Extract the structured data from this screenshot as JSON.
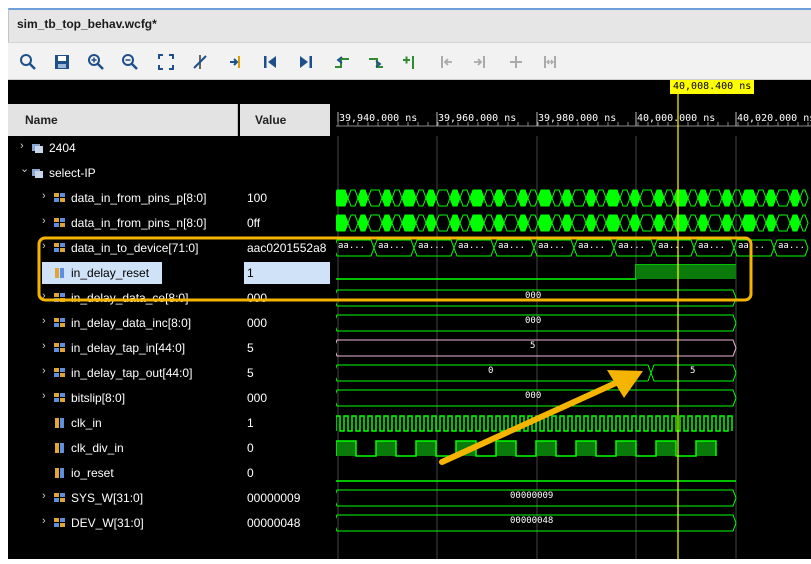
{
  "window": {
    "title": "sim_tb_top_behav.wcfg*"
  },
  "toolbar": {
    "buttons": [
      {
        "name": "search-icon"
      },
      {
        "name": "save-icon"
      },
      {
        "name": "zoom-in-icon"
      },
      {
        "name": "zoom-out-icon"
      },
      {
        "name": "zoom-fit-icon"
      },
      {
        "name": "cursor-clear-icon"
      },
      {
        "name": "go-to-cursor-icon"
      },
      {
        "name": "go-to-start-icon"
      },
      {
        "name": "go-to-end-icon"
      },
      {
        "name": "previous-transition-icon"
      },
      {
        "name": "next-transition-icon"
      },
      {
        "name": "add-marker-icon"
      },
      {
        "name": "previous-marker-icon"
      },
      {
        "name": "next-marker-icon"
      },
      {
        "name": "swap-cursors-icon"
      },
      {
        "name": "snap-icon"
      }
    ]
  },
  "headers": {
    "name": "Name",
    "value": "Value"
  },
  "cursor": {
    "label": "40,008.400 ns",
    "color": "#ffff00"
  },
  "timeline": {
    "ticks": [
      "39,940.000 ns",
      "39,960.000 ns",
      "39,980.000 ns",
      "40,000.000 ns",
      "40,020.000 ns"
    ]
  },
  "signals": [
    {
      "name": "2404",
      "value": "",
      "type": "group",
      "expanded": false
    },
    {
      "name": "select-IP",
      "value": "",
      "type": "group",
      "expanded": true
    },
    {
      "name": "data_in_from_pins_p[8:0]",
      "value": "100",
      "type": "bus"
    },
    {
      "name": "data_in_from_pins_n[8:0]",
      "value": "0ff",
      "type": "bus"
    },
    {
      "name": "data_in_to_device[71:0]",
      "value": "aac0201552a8",
      "type": "bus"
    },
    {
      "name": "in_delay_reset",
      "value": "1",
      "type": "bit",
      "selected": true
    },
    {
      "name": "in_delay_data_ce[8:0]",
      "value": "000",
      "type": "bus"
    },
    {
      "name": "in_delay_data_inc[8:0]",
      "value": "000",
      "type": "bus"
    },
    {
      "name": "in_delay_tap_in[44:0]",
      "value": "5",
      "type": "bus"
    },
    {
      "name": "in_delay_tap_out[44:0]",
      "value": "5",
      "type": "bus"
    },
    {
      "name": "bitslip[8:0]",
      "value": "000",
      "type": "bus"
    },
    {
      "name": "clk_in",
      "value": "1",
      "type": "bit"
    },
    {
      "name": "clk_div_in",
      "value": "0",
      "type": "bit"
    },
    {
      "name": "io_reset",
      "value": "0",
      "type": "bit"
    },
    {
      "name": "SYS_W[31:0]",
      "value": "00000009",
      "type": "bus"
    },
    {
      "name": "DEV_W[31:0]",
      "value": "00000048",
      "type": "bus"
    }
  ],
  "wave_values": {
    "device_seg": "aa...",
    "ce": "000",
    "inc": "000",
    "tap_in": "5",
    "tap_out_before": "0",
    "tap_out_after": "5",
    "bitslip": "000",
    "sys_w": "00000009",
    "dev_w": "00000048"
  },
  "annotation": {
    "highlight_color": "#f5b400",
    "arrow_color": "#f5b400"
  }
}
